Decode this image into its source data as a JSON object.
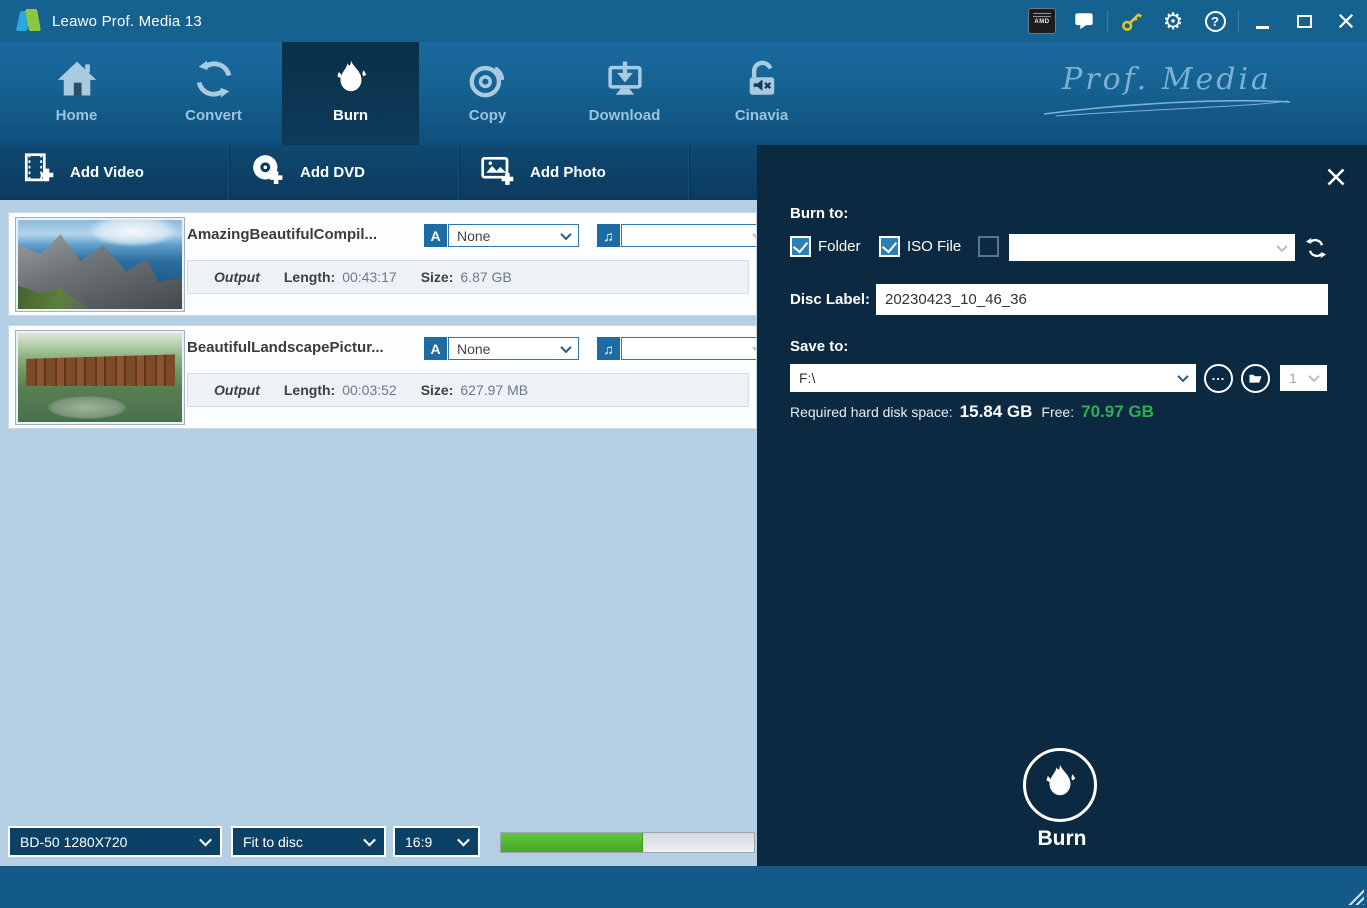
{
  "theme": {
    "titlebar-bg": "#15618f",
    "nav-bottom": "#0f4e7c",
    "list-bg": "#b4cfe3",
    "panel-bg": "#0b2940",
    "footer-bg": "#13598a",
    "accent-blue": "#1c6ca3",
    "green": "#2fae52",
    "progress-green": "#4cb02c",
    "key-gold": "#e9c71d"
  },
  "titlebar": {
    "app_title": "Leawo Prof. Media 13"
  },
  "nav": {
    "brand_script": "Prof. Media",
    "tabs": [
      {
        "label": "Home",
        "icon": "home-icon",
        "active": false
      },
      {
        "label": "Convert",
        "icon": "convert-icon",
        "active": false
      },
      {
        "label": "Burn",
        "icon": "burn-icon",
        "active": true
      },
      {
        "label": "Copy",
        "icon": "copy-icon",
        "active": false
      },
      {
        "label": "Download",
        "icon": "download-icon",
        "active": false
      },
      {
        "label": "Cinavia",
        "icon": "cinavia-icon",
        "active": false
      }
    ]
  },
  "toolbar": {
    "buttons": [
      {
        "label": "Add Video",
        "icon": "add-video-icon"
      },
      {
        "label": "Add DVD",
        "icon": "add-dvd-icon"
      },
      {
        "label": "Add Photo",
        "icon": "add-photo-icon"
      }
    ]
  },
  "icons": {
    "subtitle_glyph": "A",
    "audio_glyph": "♫"
  },
  "media_list": {
    "items": [
      {
        "title": "AmazingBeautifulCompil...",
        "output_label": "Output",
        "length_label": "Length:",
        "length": "00:43:17",
        "size_label": "Size:",
        "size": "6.87 GB",
        "subtitle_value": "None",
        "audio_value": ""
      },
      {
        "title": "BeautifulLandscapePictur...",
        "output_label": "Output",
        "length_label": "Length:",
        "length": "00:03:52",
        "size_label": "Size:",
        "size": "627.97 MB",
        "subtitle_value": "None",
        "audio_value": ""
      }
    ]
  },
  "bottom_bar": {
    "disc_model": "BD-50 1280X720",
    "fit_mode": "Fit to disc",
    "aspect_ratio": "16:9",
    "progress_percent": 56
  },
  "burn_panel": {
    "burn_to_label": "Burn to:",
    "folder_option": {
      "label": "Folder",
      "checked": true
    },
    "iso_option": {
      "label": "ISO File",
      "checked": true
    },
    "device_option": {
      "checked": false
    },
    "device_value": "",
    "disc_label_label": "Disc Label:",
    "disc_label_value": "20230423_10_46_36",
    "save_to_label": "Save to:",
    "save_path": "F:\\",
    "copies_value": "1",
    "required_label": "Required hard disk space:",
    "required_value": "15.84 GB",
    "free_label": "Free:",
    "free_value": "70.97 GB",
    "burn_label": "Burn"
  }
}
